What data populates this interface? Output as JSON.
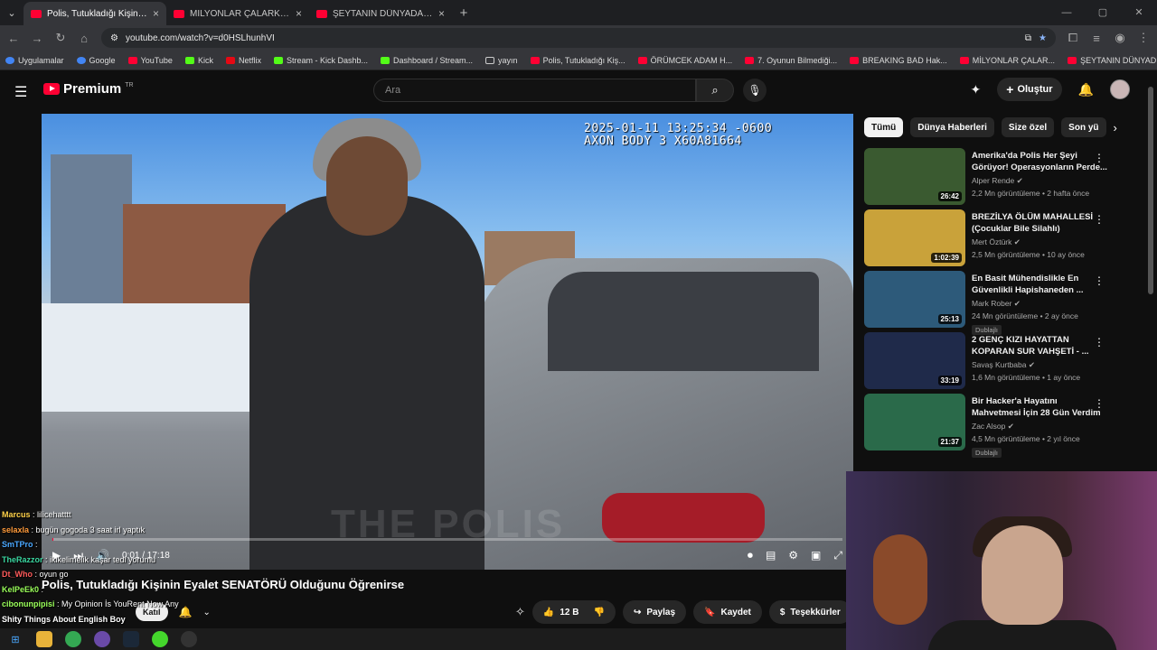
{
  "browser": {
    "tabs": [
      {
        "label": "Polis, Tutukladığı Kişinin Eyalet",
        "active": true
      },
      {
        "label": "MİLYONLAR ÇALARKEN VLOG",
        "active": false
      },
      {
        "label": "ŞEYTANIN DÜNYADAKİ YÜZÜ",
        "active": false
      }
    ],
    "url": "youtube.com/watch?v=d0HSLhunhVI",
    "bookmarks": [
      "Uygulamalar",
      "Google",
      "YouTube",
      "Kick",
      "Netflix",
      "Stream - Kick Dashb...",
      "Dashboard / Stream...",
      "yayın",
      "Polis, Tutukladığı Kiş...",
      "ÖRÜMCEK ADAM H...",
      "7. Oyunun Bilmediği...",
      "BREAKING BAD Hak...",
      "MİLYONLAR ÇALAR...",
      "ŞEYTANIN DÜNYAD..."
    ]
  },
  "header": {
    "logo": "Premium",
    "country_code": "TR",
    "search_placeholder": "Ara",
    "create_label": "Oluştur"
  },
  "video": {
    "timestamp_line1": "2025-01-11 13:25:34 -0600",
    "timestamp_line2": "AXON BODY 3 X60A81664",
    "watermark": "THE POLIS",
    "time": "0:01 / 17:18",
    "progress": 0.001,
    "title": "Polis, Tutukladığı Kişinin Eyalet SENATÖRÜ Olduğunu Öğrenirse"
  },
  "actions": {
    "join": "Katıl",
    "like_count": "12 B",
    "share": "Paylaş",
    "save": "Kaydet",
    "thanks": "Teşekkürler"
  },
  "chips": [
    "Tümü",
    "Dünya Haberleri",
    "Size özel",
    "Son yü"
  ],
  "recommendations": [
    {
      "title": "Amerika'da Polis Her Şeyi Görüyor! Operasyonların Perde...",
      "channel": "Alper Rende",
      "meta": "2,2 Mn görüntüleme • 2 hafta önce",
      "duration": "26:42",
      "badge": "",
      "color": "#3a5a30"
    },
    {
      "title": "BREZİLYA ÖLÜM MAHALLESİ (Çocuklar Bile Silahlı)",
      "channel": "Mert Öztürk",
      "meta": "2,5 Mn görüntüleme • 10 ay önce",
      "duration": "1:02:39",
      "badge": "",
      "color": "#c9a23a"
    },
    {
      "title": "En Basit Mühendislikle En Güvenlikli Hapishaneden ...",
      "channel": "Mark Rober",
      "meta": "24 Mn görüntüleme • 2 ay önce",
      "duration": "25:13",
      "badge": "Dublajlı",
      "color": "#2d5a7a"
    },
    {
      "title": "2 GENÇ KIZI HAYATTAN KOPARAN SUR VAHŞETİ - ...",
      "channel": "Savaş Kurtbaba",
      "meta": "1,6 Mn görüntüleme • 1 ay önce",
      "duration": "33:19",
      "badge": "",
      "color": "#1f2a4a"
    },
    {
      "title": "Bir Hacker'a Hayatını Mahvetmesi İçin 28 Gün Verdim",
      "channel": "Zac Alsop",
      "meta": "4,5 Mn görüntüleme • 2 yıl önce",
      "duration": "21:37",
      "badge": "Dublajlı",
      "color": "#2a6a4a"
    }
  ],
  "chat": [
    {
      "user": "Marcus",
      "msg": "lilicehatttt",
      "color": "#ffd24a"
    },
    {
      "user": "selaxla",
      "msg": "bugün gogoda 3 saat irl yaptık",
      "color": "#ff9a3a"
    },
    {
      "user": "SmTPro",
      "msg": "",
      "color": "#4aa8ff"
    },
    {
      "user": "TheRazzor",
      "msg": "ikikelimelik kaşar tedi yorumu",
      "color": "#3ad6a0"
    },
    {
      "user": "Dt_Who",
      "msg": "oyun go",
      "color": "#ff5a5a"
    },
    {
      "user": "KelPeEk0",
      "msg": "",
      "color": "#9aff5a"
    },
    {
      "user": "cibonunpipisi",
      "msg": "My Opinion İs YouRent Now Any",
      "color": "#9aff5a"
    },
    {
      "user": "",
      "msg": "Shity Things About English Boy",
      "color": "#ffffff"
    }
  ]
}
